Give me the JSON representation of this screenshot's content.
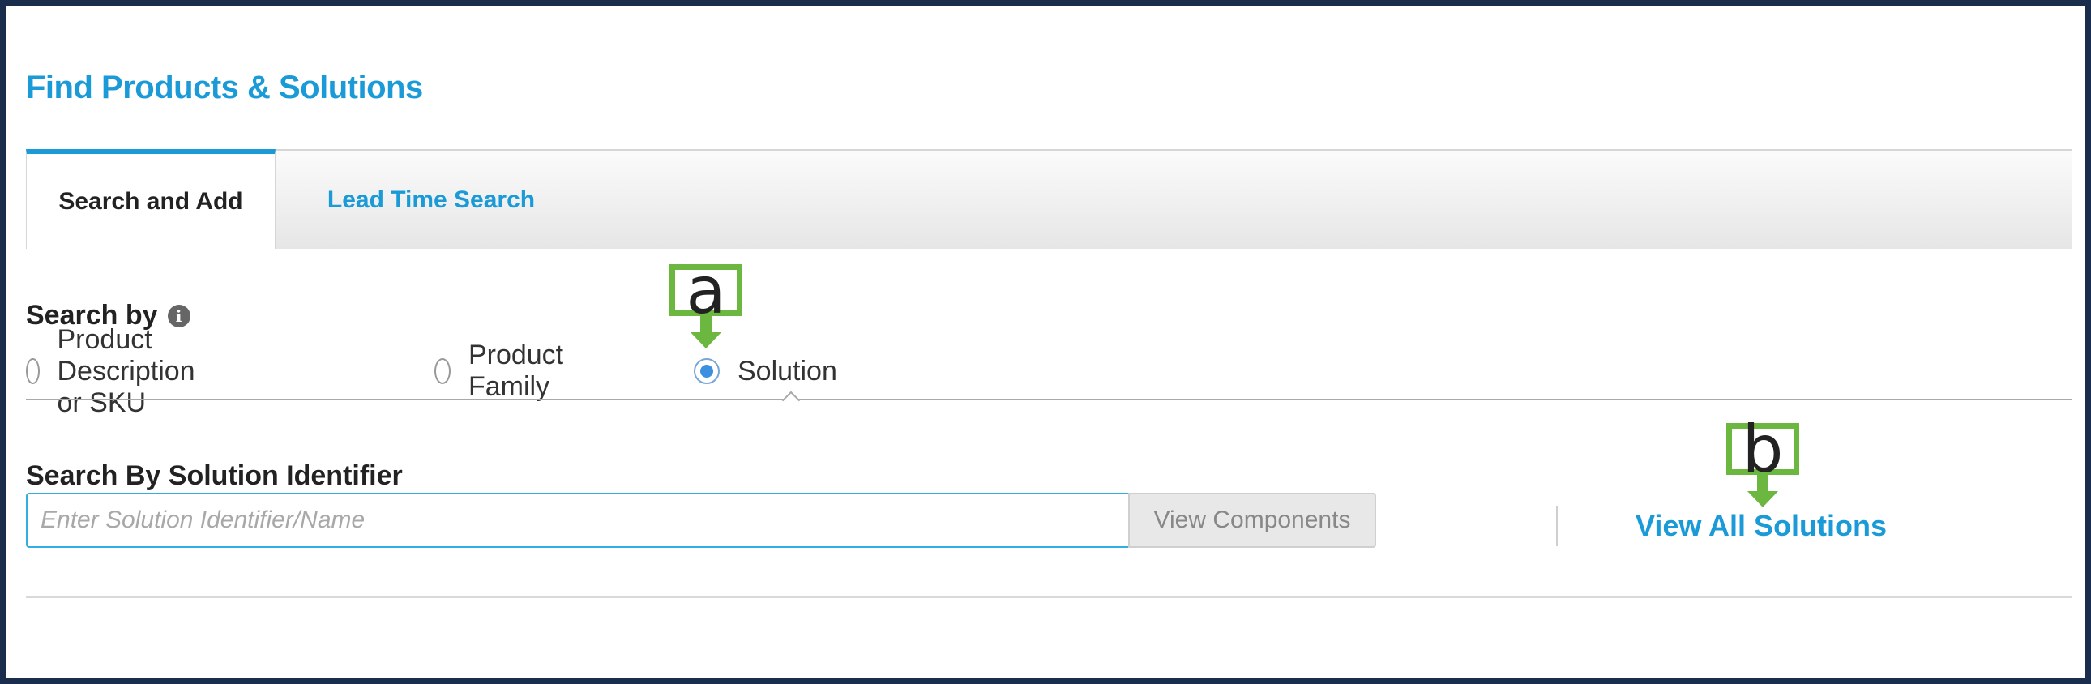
{
  "header": {
    "title": "Find Products & Solutions"
  },
  "tabs": [
    {
      "label": "Search and Add",
      "active": true
    },
    {
      "label": "Lead Time Search",
      "active": false
    }
  ],
  "search_by": {
    "label": "Search by",
    "info_icon": "info-icon",
    "options": [
      {
        "label": "Product Description or SKU",
        "checked": false
      },
      {
        "label": "Product Family",
        "checked": false
      },
      {
        "label": "Solution",
        "checked": true
      }
    ]
  },
  "solution_search": {
    "label": "Search By Solution Identifier",
    "input_value": "",
    "input_placeholder": "Enter Solution Identifier/Name",
    "button_label": "View Components",
    "view_all_link": "View All Solutions"
  },
  "callouts": [
    {
      "letter": "a"
    },
    {
      "letter": "b"
    }
  ],
  "colors": {
    "accent": "#1a9ad6",
    "callout": "#6bb740",
    "frame": "#1b2d4c"
  }
}
